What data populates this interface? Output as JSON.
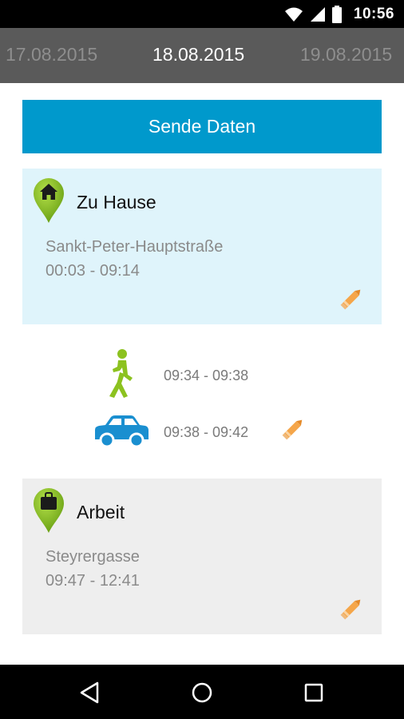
{
  "status_bar": {
    "time": "10:56",
    "icons": [
      "wifi-icon",
      "signal-icon",
      "battery-icon"
    ]
  },
  "date_nav": {
    "prev": "17.08.2015",
    "current": "18.08.2015",
    "next": "19.08.2015"
  },
  "send_button": {
    "label": "Sende Daten",
    "color": "#0099cc"
  },
  "places": [
    {
      "title": "Zu Hause",
      "street": "Sankt-Peter-Hauptstraße",
      "time": "00:03 - 09:14",
      "icon": "home-pin-icon",
      "background": "#dff4fb"
    },
    {
      "title": "Arbeit",
      "street": "Steyrergasse",
      "time": "09:47 - 12:41",
      "icon": "work-pin-icon",
      "background": "#eeeeee"
    }
  ],
  "travels": [
    {
      "mode": "walk-icon",
      "time": "09:34 - 09:38",
      "color": "#8cc21f"
    },
    {
      "mode": "car-icon",
      "time": "09:38 - 09:42",
      "color": "#1a8fd0"
    }
  ],
  "colors": {
    "pin_green": "#8cc21f",
    "edit_orange": "#f5a64a",
    "date_bar": "#5a5a5a"
  },
  "nav_bar": {
    "buttons": [
      "back-icon",
      "home-icon",
      "recents-icon"
    ]
  }
}
